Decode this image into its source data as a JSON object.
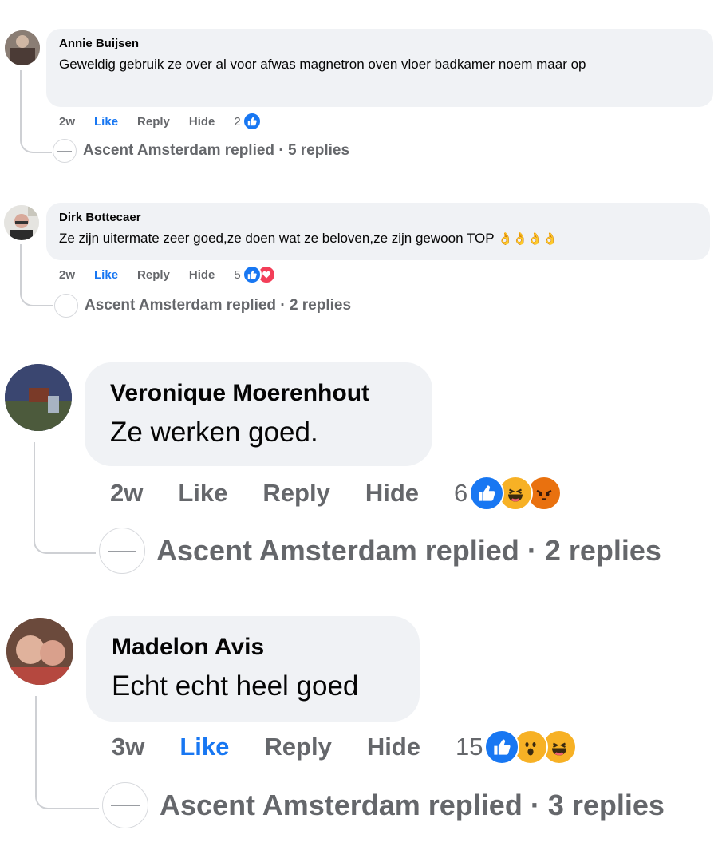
{
  "comments": [
    {
      "author": "Annie Buijsen",
      "text": "Geweldig gebruik ze over al voor afwas magnetron oven vloer badkamer noem maar op",
      "time": "2w",
      "like": "Like",
      "reply": "Reply",
      "hide": "Hide",
      "liked": true,
      "reaction_count": "2",
      "reactions": [
        "like-icon"
      ],
      "replied_by": "Ascent Amsterdam replied",
      "replies": "5 replies"
    },
    {
      "author": "Dirk Bottecaer",
      "text": "Ze zijn uitermate zeer goed,ze doen wat ze beloven,ze zijn gewoon TOP",
      "emoji": "👌👌👌👌",
      "time": "2w",
      "like": "Like",
      "reply": "Reply",
      "hide": "Hide",
      "liked": true,
      "reaction_count": "5",
      "reactions": [
        "like-icon",
        "love-icon"
      ],
      "replied_by": "Ascent Amsterdam replied",
      "replies": "2 replies"
    },
    {
      "author": "Veronique Moerenhout",
      "text": "Ze werken goed.",
      "time": "2w",
      "like": "Like",
      "reply": "Reply",
      "hide": "Hide",
      "liked": false,
      "reaction_count": "6",
      "reactions": [
        "like-icon",
        "haha-icon",
        "angry-icon"
      ],
      "replied_by": "Ascent Amsterdam replied",
      "replies": "2 replies"
    },
    {
      "author": "Madelon Avis",
      "text": "Echt echt heel goed",
      "time": "3w",
      "like": "Like",
      "reply": "Reply",
      "hide": "Hide",
      "liked": true,
      "reaction_count": "15",
      "reactions": [
        "like-icon",
        "wow-icon",
        "haha-icon"
      ],
      "replied_by": "Ascent Amsterdam replied",
      "replies": "3 replies"
    }
  ],
  "separator": " · ",
  "colors": {
    "like_blue": "#1877f2",
    "love_red": "#f33e58",
    "reaction_yellow": "#f7b125",
    "angry_orange": "#e9710f",
    "bubble_bg": "#f0f2f5",
    "meta_grey": "#65676b"
  }
}
